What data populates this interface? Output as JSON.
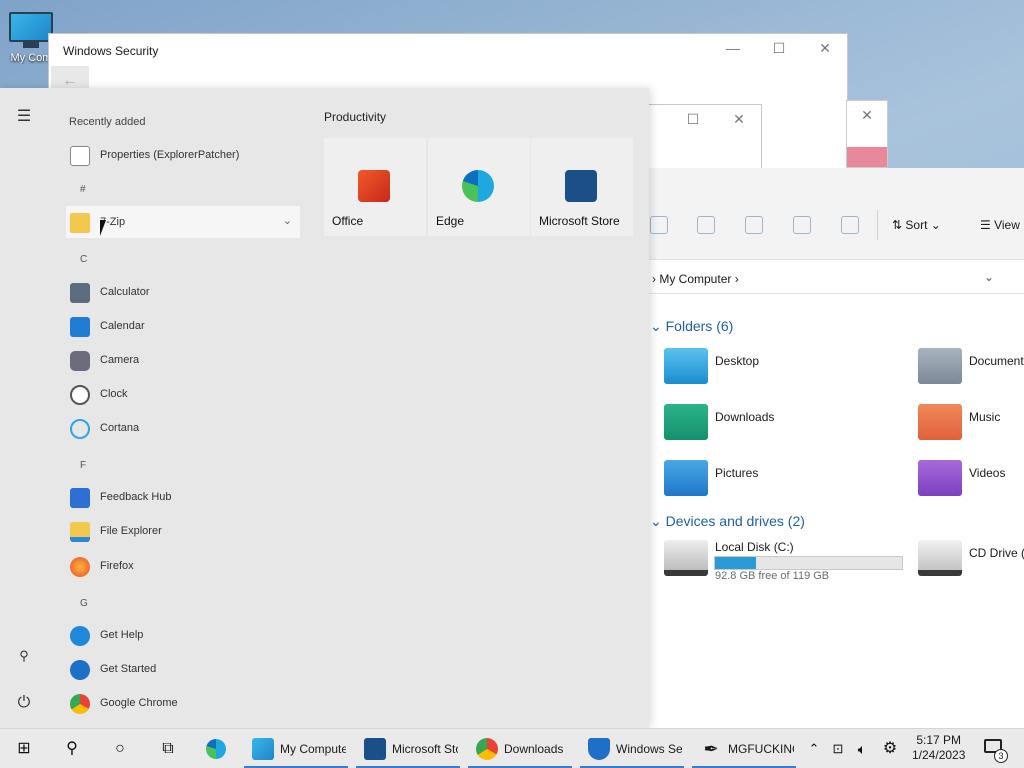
{
  "desktop": {
    "icon_label": "My Com"
  },
  "windows_security": {
    "title": "Windows Security",
    "back": "←",
    "min": "—",
    "max": "☐",
    "close": "✕"
  },
  "mid_window": {
    "max": "☐",
    "close": "✕"
  },
  "pink_window": {
    "close": "✕"
  },
  "start": {
    "recently_added": "Recently added",
    "recent_items": [
      {
        "label": "Properties (ExplorerPatcher)"
      }
    ],
    "sections": [
      {
        "letter": "#",
        "apps": [
          {
            "label": "7-Zip",
            "chevron": "⌄"
          }
        ]
      },
      {
        "letter": "C",
        "apps": [
          {
            "label": "Calculator"
          },
          {
            "label": "Calendar"
          },
          {
            "label": "Camera"
          },
          {
            "label": "Clock"
          },
          {
            "label": "Cortana"
          }
        ]
      },
      {
        "letter": "F",
        "apps": [
          {
            "label": "Feedback Hub"
          },
          {
            "label": "File Explorer"
          },
          {
            "label": "Firefox"
          }
        ]
      },
      {
        "letter": "G",
        "apps": [
          {
            "label": "Get Help"
          },
          {
            "label": "Get Started"
          },
          {
            "label": "Google Chrome"
          }
        ]
      }
    ],
    "pinned_header": "Productivity",
    "tiles": [
      {
        "label": "Office"
      },
      {
        "label": "Edge"
      },
      {
        "label": "Microsoft Store"
      }
    ]
  },
  "explorer": {
    "sort_label": "Sort",
    "view_label": "View",
    "breadcrumb": "My Computer",
    "breadcrumb_sep": "›",
    "folders_header": "Folders (6)",
    "folders": [
      {
        "label": "Desktop"
      },
      {
        "label": "Documents"
      },
      {
        "label": "Downloads"
      },
      {
        "label": "Music"
      },
      {
        "label": "Pictures"
      },
      {
        "label": "Videos"
      }
    ],
    "drives_header": "Devices and drives (2)",
    "drives": [
      {
        "label": "Local Disk (C:)",
        "free_text": "92.8 GB free of 119 GB",
        "used_fraction": 0.22
      },
      {
        "label": "CD Drive (D:)"
      }
    ]
  },
  "taskbar": {
    "apps": [
      {
        "label": "My Computer"
      },
      {
        "label": "Microsoft Store"
      },
      {
        "label": "Downloads"
      },
      {
        "label": "Windows Security"
      },
      {
        "label": "MGFUCKING"
      }
    ],
    "time": "5:17 PM",
    "date": "1/24/2023",
    "notification_count": "3"
  },
  "colors": {
    "accent": "#3a7bd5",
    "folder_header": "#1f5faa",
    "drive_bar": "#2a9bd8"
  }
}
